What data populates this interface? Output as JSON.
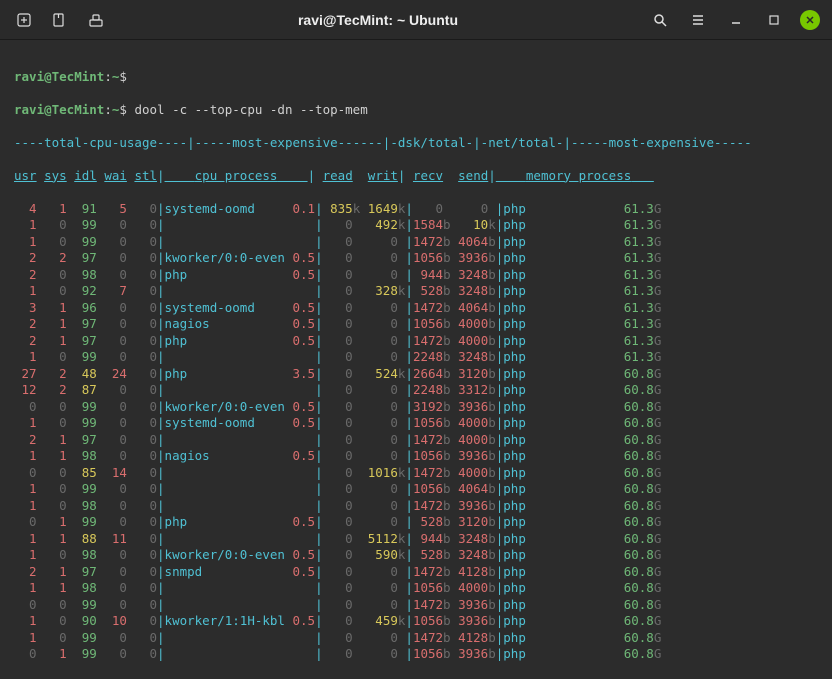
{
  "title": "ravi@TecMint: ~ Ubuntu",
  "prompt_user": "ravi@TecMint",
  "prompt_path": "~",
  "prompt_symbol": "$",
  "command": "dool -c --top-cpu -dn --top-mem",
  "headers": {
    "grp_cpu": "total-cpu-usage",
    "grp_cpu_exp": "most-expensive",
    "grp_dsk": "dsk/total",
    "grp_net": "net/total",
    "grp_mem_exp": "most-expensive",
    "usr": "usr",
    "sys": "sys",
    "idl": "idl",
    "wai": "wai",
    "stl": "stl",
    "cpu_process": "cpu process",
    "read": "read",
    "writ": "writ",
    "recv": "recv",
    "send": "send",
    "memory_process": "memory process"
  },
  "rows": [
    {
      "usr": "4",
      "sys": "1",
      "idl": "91",
      "wai": "5",
      "stl": "0",
      "proc": "systemd-oomd",
      "cpu": "0.1",
      "read": "835",
      "read_u": "k",
      "writ": "1649",
      "writ_u": "k",
      "recv": "0",
      "send": "0",
      "mem_proc": "php",
      "mem": "61.3"
    },
    {
      "usr": "1",
      "sys": "0",
      "idl": "99",
      "wai": "0",
      "stl": "0",
      "proc": "",
      "cpu": "",
      "read": "0",
      "writ": "492",
      "writ_u": "k",
      "recv": "1584",
      "recv_u": "b",
      "send": "10",
      "send_u": "k",
      "mem_proc": "php",
      "mem": "61.3"
    },
    {
      "usr": "1",
      "sys": "0",
      "idl": "99",
      "wai": "0",
      "stl": "0",
      "proc": "",
      "cpu": "",
      "read": "0",
      "writ": "0",
      "recv": "1472",
      "recv_u": "b",
      "send": "4064",
      "send_u": "b",
      "mem_proc": "php",
      "mem": "61.3"
    },
    {
      "usr": "2",
      "sys": "2",
      "idl": "97",
      "wai": "0",
      "stl": "0",
      "proc": "kworker/0:0-even",
      "cpu": "0.5",
      "read": "0",
      "writ": "0",
      "recv": "1056",
      "recv_u": "b",
      "send": "3936",
      "send_u": "b",
      "mem_proc": "php",
      "mem": "61.3"
    },
    {
      "usr": "2",
      "sys": "0",
      "idl": "98",
      "wai": "0",
      "stl": "0",
      "proc": "php",
      "cpu": "0.5",
      "read": "0",
      "writ": "0",
      "recv": "944",
      "recv_u": "b",
      "send": "3248",
      "send_u": "b",
      "mem_proc": "php",
      "mem": "61.3"
    },
    {
      "usr": "1",
      "sys": "0",
      "idl": "92",
      "wai": "7",
      "stl": "0",
      "proc": "",
      "cpu": "",
      "read": "0",
      "writ": "328",
      "writ_u": "k",
      "recv": "528",
      "recv_u": "b",
      "send": "3248",
      "send_u": "b",
      "mem_proc": "php",
      "mem": "61.3"
    },
    {
      "usr": "3",
      "sys": "1",
      "idl": "96",
      "wai": "0",
      "stl": "0",
      "proc": "systemd-oomd",
      "cpu": "0.5",
      "read": "0",
      "writ": "0",
      "recv": "1472",
      "recv_u": "b",
      "send": "4064",
      "send_u": "b",
      "mem_proc": "php",
      "mem": "61.3"
    },
    {
      "usr": "2",
      "sys": "1",
      "idl": "97",
      "wai": "0",
      "stl": "0",
      "proc": "nagios",
      "cpu": "0.5",
      "read": "0",
      "writ": "0",
      "recv": "1056",
      "recv_u": "b",
      "send": "4000",
      "send_u": "b",
      "mem_proc": "php",
      "mem": "61.3"
    },
    {
      "usr": "2",
      "sys": "1",
      "idl": "97",
      "wai": "0",
      "stl": "0",
      "proc": "php",
      "cpu": "0.5",
      "read": "0",
      "writ": "0",
      "recv": "1472",
      "recv_u": "b",
      "send": "4000",
      "send_u": "b",
      "mem_proc": "php",
      "mem": "61.3"
    },
    {
      "usr": "1",
      "sys": "0",
      "idl": "99",
      "wai": "0",
      "stl": "0",
      "proc": "",
      "cpu": "",
      "read": "0",
      "writ": "0",
      "recv": "2248",
      "recv_u": "b",
      "send": "3248",
      "send_u": "b",
      "mem_proc": "php",
      "mem": "61.3"
    },
    {
      "usr": "27",
      "sys": "2",
      "idl": "48",
      "wai": "24",
      "stl": "0",
      "proc": "php",
      "cpu": "3.5",
      "read": "0",
      "writ": "524",
      "writ_u": "k",
      "recv": "2664",
      "recv_u": "b",
      "send": "3120",
      "send_u": "b",
      "mem_proc": "php",
      "mem": "60.8"
    },
    {
      "usr": "12",
      "sys": "2",
      "idl": "87",
      "wai": "0",
      "stl": "0",
      "proc": "",
      "cpu": "",
      "read": "0",
      "writ": "0",
      "recv": "2248",
      "recv_u": "b",
      "send": "3312",
      "send_u": "b",
      "mem_proc": "php",
      "mem": "60.8"
    },
    {
      "usr": "0",
      "sys": "0",
      "idl": "99",
      "wai": "0",
      "stl": "0",
      "proc": "kworker/0:0-even",
      "cpu": "0.5",
      "read": "0",
      "writ": "0",
      "recv": "3192",
      "recv_u": "b",
      "send": "3936",
      "send_u": "b",
      "mem_proc": "php",
      "mem": "60.8"
    },
    {
      "usr": "1",
      "sys": "0",
      "idl": "99",
      "wai": "0",
      "stl": "0",
      "proc": "systemd-oomd",
      "cpu": "0.5",
      "read": "0",
      "writ": "0",
      "recv": "1056",
      "recv_u": "b",
      "send": "4000",
      "send_u": "b",
      "mem_proc": "php",
      "mem": "60.8"
    },
    {
      "usr": "2",
      "sys": "1",
      "idl": "97",
      "wai": "0",
      "stl": "0",
      "proc": "",
      "cpu": "",
      "read": "0",
      "writ": "0",
      "recv": "1472",
      "recv_u": "b",
      "send": "4000",
      "send_u": "b",
      "mem_proc": "php",
      "mem": "60.8"
    },
    {
      "usr": "1",
      "sys": "1",
      "idl": "98",
      "wai": "0",
      "stl": "0",
      "proc": "nagios",
      "cpu": "0.5",
      "read": "0",
      "writ": "0",
      "recv": "1056",
      "recv_u": "b",
      "send": "3936",
      "send_u": "b",
      "mem_proc": "php",
      "mem": "60.8"
    },
    {
      "usr": "0",
      "sys": "0",
      "idl": "85",
      "wai": "14",
      "stl": "0",
      "proc": "",
      "cpu": "",
      "read": "0",
      "writ": "1016",
      "writ_u": "k",
      "recv": "1472",
      "recv_u": "b",
      "send": "4000",
      "send_u": "b",
      "mem_proc": "php",
      "mem": "60.8"
    },
    {
      "usr": "1",
      "sys": "0",
      "idl": "99",
      "wai": "0",
      "stl": "0",
      "proc": "",
      "cpu": "",
      "read": "0",
      "writ": "0",
      "recv": "1056",
      "recv_u": "b",
      "send": "4064",
      "send_u": "b",
      "mem_proc": "php",
      "mem": "60.8"
    },
    {
      "usr": "1",
      "sys": "0",
      "idl": "98",
      "wai": "0",
      "stl": "0",
      "proc": "",
      "cpu": "",
      "read": "0",
      "writ": "0",
      "recv": "1472",
      "recv_u": "b",
      "send": "3936",
      "send_u": "b",
      "mem_proc": "php",
      "mem": "60.8"
    },
    {
      "usr": "0",
      "sys": "1",
      "idl": "99",
      "wai": "0",
      "stl": "0",
      "proc": "php",
      "cpu": "0.5",
      "read": "0",
      "writ": "0",
      "recv": "528",
      "recv_u": "b",
      "send": "3120",
      "send_u": "b",
      "mem_proc": "php",
      "mem": "60.8"
    },
    {
      "usr": "1",
      "sys": "1",
      "idl": "88",
      "wai": "11",
      "stl": "0",
      "proc": "",
      "cpu": "",
      "read": "0",
      "writ": "5112",
      "writ_u": "k",
      "recv": "944",
      "recv_u": "b",
      "send": "3248",
      "send_u": "b",
      "mem_proc": "php",
      "mem": "60.8"
    },
    {
      "usr": "1",
      "sys": "0",
      "idl": "98",
      "wai": "0",
      "stl": "0",
      "proc": "kworker/0:0-even",
      "cpu": "0.5",
      "read": "0",
      "writ": "590",
      "writ_u": "k",
      "recv": "528",
      "recv_u": "b",
      "send": "3248",
      "send_u": "b",
      "mem_proc": "php",
      "mem": "60.8"
    },
    {
      "usr": "2",
      "sys": "1",
      "idl": "97",
      "wai": "0",
      "stl": "0",
      "proc": "snmpd",
      "cpu": "0.5",
      "read": "0",
      "writ": "0",
      "recv": "1472",
      "recv_u": "b",
      "send": "4128",
      "send_u": "b",
      "mem_proc": "php",
      "mem": "60.8"
    },
    {
      "usr": "1",
      "sys": "1",
      "idl": "98",
      "wai": "0",
      "stl": "0",
      "proc": "",
      "cpu": "",
      "read": "0",
      "writ": "0",
      "recv": "1056",
      "recv_u": "b",
      "send": "4000",
      "send_u": "b",
      "mem_proc": "php",
      "mem": "60.8"
    },
    {
      "usr": "0",
      "sys": "0",
      "idl": "99",
      "wai": "0",
      "stl": "0",
      "proc": "",
      "cpu": "",
      "read": "0",
      "writ": "0",
      "recv": "1472",
      "recv_u": "b",
      "send": "3936",
      "send_u": "b",
      "mem_proc": "php",
      "mem": "60.8"
    },
    {
      "usr": "1",
      "sys": "0",
      "idl": "90",
      "wai": "10",
      "stl": "0",
      "proc": "kworker/1:1H-kbl",
      "cpu": "0.5",
      "read": "0",
      "writ": "459",
      "writ_u": "k",
      "recv": "1056",
      "recv_u": "b",
      "send": "3936",
      "send_u": "b",
      "mem_proc": "php",
      "mem": "60.8"
    },
    {
      "usr": "1",
      "sys": "0",
      "idl": "99",
      "wai": "0",
      "stl": "0",
      "proc": "",
      "cpu": "",
      "read": "0",
      "writ": "0",
      "recv": "1472",
      "recv_u": "b",
      "send": "4128",
      "send_u": "b",
      "mem_proc": "php",
      "mem": "60.8"
    },
    {
      "usr": "0",
      "sys": "1",
      "idl": "99",
      "wai": "0",
      "stl": "0",
      "proc": "",
      "cpu": "",
      "read": "0",
      "writ": "0",
      "recv": "1056",
      "recv_u": "b",
      "send": "3936",
      "send_u": "b",
      "mem_proc": "php",
      "mem": "60.8"
    }
  ]
}
